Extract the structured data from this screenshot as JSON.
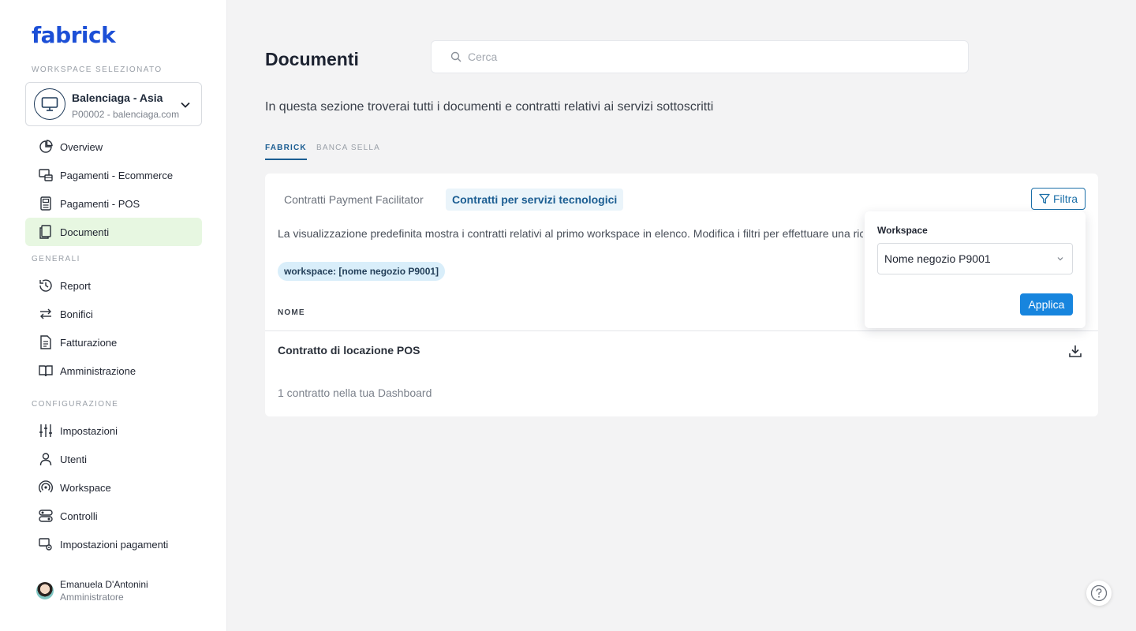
{
  "brand": {
    "logo_text": "fabrick",
    "logo_color": "#1c4fd6"
  },
  "sidebar": {
    "workspace_label": "WORKSPACE SELEZIONATO",
    "workspace": {
      "name": "Balenciaga - Asia",
      "subtitle": "P00002 - balenciaga.com"
    },
    "main_items": [
      {
        "label": "Overview",
        "icon": "pie-chart-icon"
      },
      {
        "label": "Pagamenti - Ecommerce",
        "icon": "ecommerce-icon"
      },
      {
        "label": "Pagamenti - POS",
        "icon": "pos-icon"
      },
      {
        "label": "Documenti",
        "icon": "document-icon",
        "active": true
      }
    ],
    "section_generali": "GENERALI",
    "generali_items": [
      {
        "label": "Report",
        "icon": "report-icon"
      },
      {
        "label": "Bonifici",
        "icon": "transfer-icon"
      },
      {
        "label": "Fatturazione",
        "icon": "invoice-icon"
      },
      {
        "label": "Amministrazione",
        "icon": "book-icon"
      }
    ],
    "section_configurazione": "CONFIGURAZIONE",
    "config_items": [
      {
        "label": "Impostazioni",
        "icon": "sliders-icon"
      },
      {
        "label": "Utenti",
        "icon": "user-icon"
      },
      {
        "label": "Workspace",
        "icon": "broadcast-icon"
      },
      {
        "label": "Controlli",
        "icon": "controls-icon"
      },
      {
        "label": "Impostazioni pagamenti",
        "icon": "payment-settings-icon"
      }
    ],
    "user": {
      "name": "Emanuela D'Antonini",
      "role": "Amministratore"
    }
  },
  "header": {
    "title": "Documenti",
    "search_placeholder": "Cerca"
  },
  "intro_text": "In questa sezione troverai tutti i documenti e contratti relativi ai servizi sottoscritti",
  "tabs": [
    {
      "label": "FABRICK",
      "active": true
    },
    {
      "label": "BANCA SELLA",
      "active": false
    }
  ],
  "card": {
    "subtabs": [
      {
        "label": "Contratti Payment Facilitator",
        "active": false
      },
      {
        "label": "Contratti per servizi tecnologici",
        "active": true
      }
    ],
    "filter_label": "Filtra",
    "info_text": "La visualizzazione predefinita mostra i contratti relativi al primo workspace in elenco. Modifica i filtri per effettuare una ricerca diversa.",
    "chip": "workspace: [nome negozio P9001]",
    "column_header": "NOME",
    "rows": [
      {
        "name": "Contratto di locazione POS"
      }
    ],
    "count_text": "1 contratto nella tua Dashboard"
  },
  "filter_popover": {
    "label": "Workspace",
    "selected": "Nome negozio P9001",
    "apply_label": "Applica"
  },
  "colors": {
    "accent": "#1b5d92",
    "primary_button": "#1785de",
    "active_nav_bg": "#e7f7e1",
    "chip_bg": "#d9eefa"
  }
}
